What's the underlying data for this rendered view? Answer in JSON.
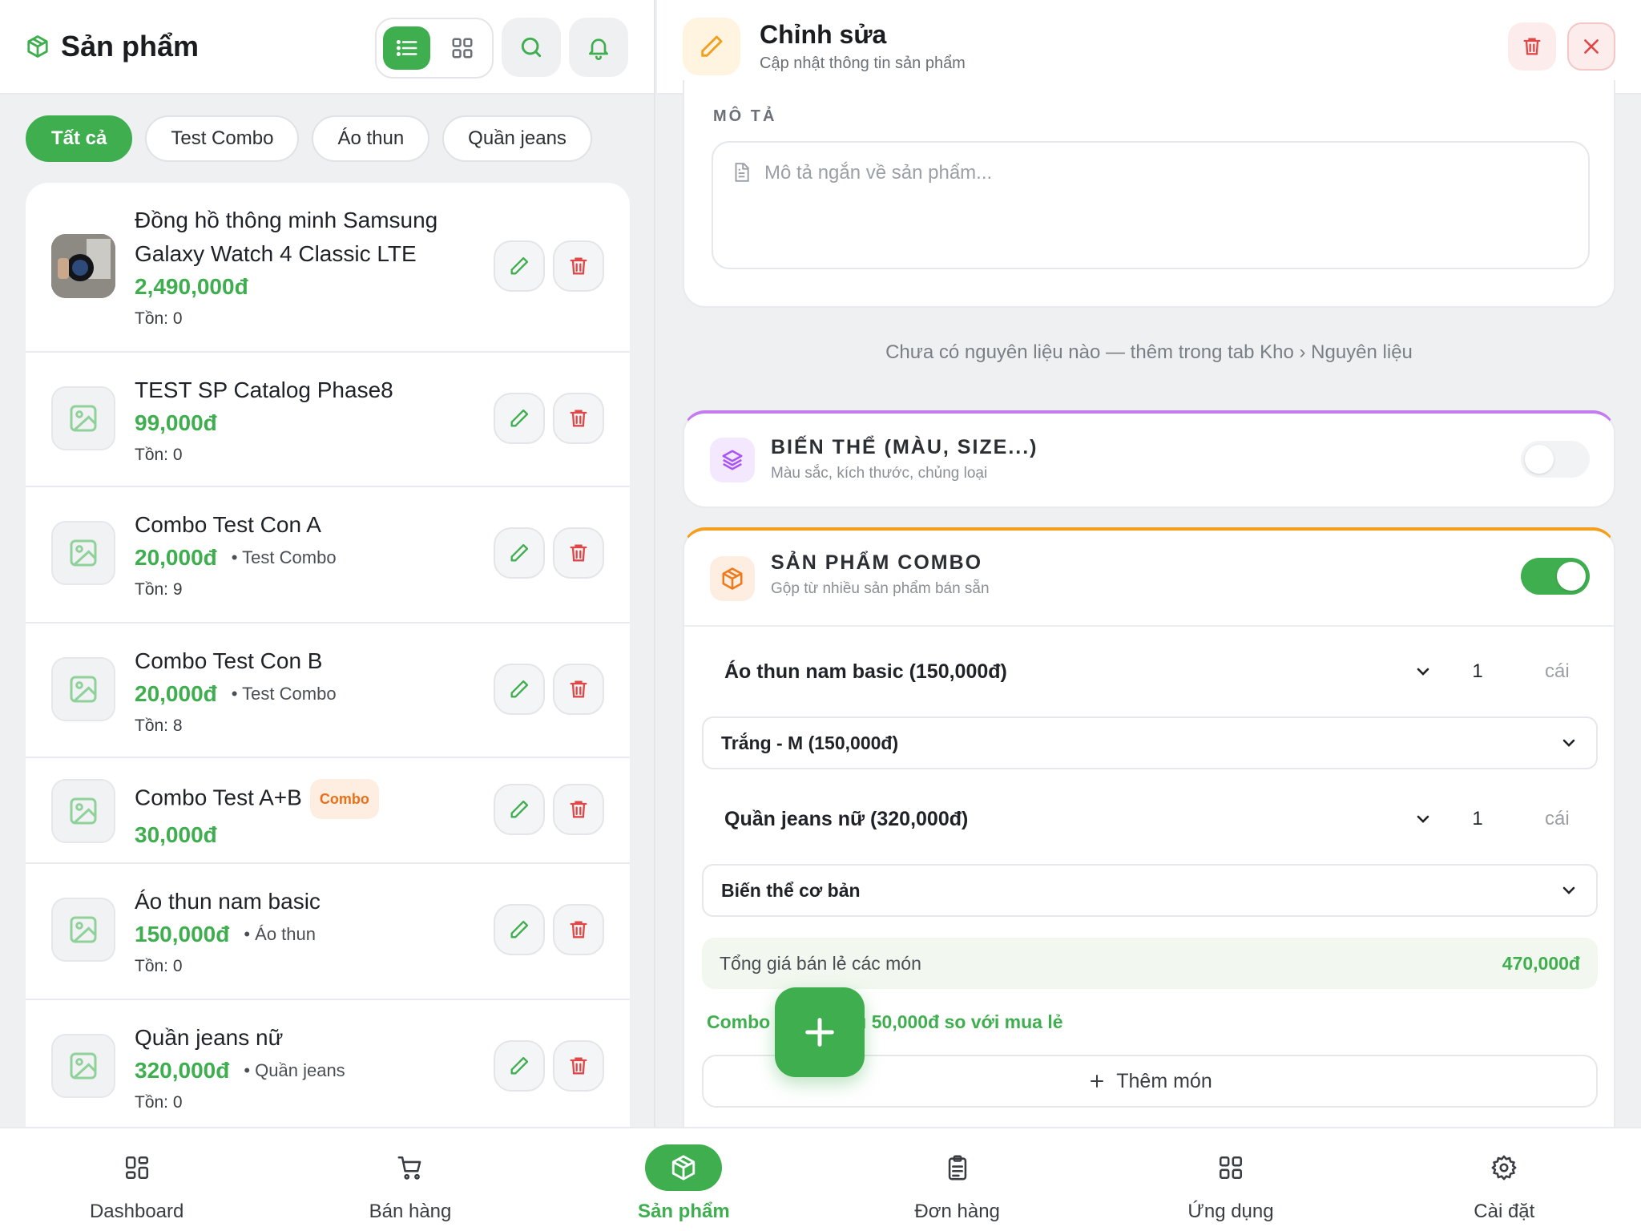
{
  "left": {
    "title": "Sản phẩm",
    "chips": [
      "Tất cả",
      "Test Combo",
      "Áo thun",
      "Quần jeans"
    ],
    "products": [
      {
        "name": "Đồng hồ thông minh Samsung Galaxy Watch 4 Classic LTE",
        "price": "2,490,000đ",
        "category": "",
        "stock": "Tồn: 0",
        "badge": ""
      },
      {
        "name": "TEST SP Catalog Phase8",
        "price": "99,000đ",
        "category": "",
        "stock": "Tồn: 0",
        "badge": ""
      },
      {
        "name": "Combo Test Con A",
        "price": "20,000đ",
        "category": "Test Combo",
        "stock": "Tồn: 9",
        "badge": ""
      },
      {
        "name": "Combo Test Con B",
        "price": "20,000đ",
        "category": "Test Combo",
        "stock": "Tồn: 8",
        "badge": ""
      },
      {
        "name": "Combo Test A+B",
        "price": "30,000đ",
        "category": "",
        "stock": "",
        "badge": "Combo"
      },
      {
        "name": "Áo thun nam basic",
        "price": "150,000đ",
        "category": "Áo thun",
        "stock": "Tồn: 0",
        "badge": ""
      },
      {
        "name": "Quần jeans nữ",
        "price": "320,000đ",
        "category": "Quần jeans",
        "stock": "Tồn: 0",
        "badge": ""
      }
    ]
  },
  "editor": {
    "title": "Chỉnh sửa",
    "subtitle": "Cập nhật thông tin sản phẩm",
    "description_label": "MÔ TẢ",
    "description_placeholder": "Mô tả ngắn về sản phẩm...",
    "ingredients_empty": "Chưa có nguyên liệu nào — thêm trong tab Kho › Nguyên liệu",
    "variants": {
      "title": "BIẾN THỂ (MÀU, SIZE...)",
      "subtitle": "Màu sắc, kích thước, chủng loại",
      "enabled": false
    },
    "combo": {
      "title": "SẢN PHẨM COMBO",
      "subtitle": "Gộp từ nhiều sản phẩm bán sẵn",
      "enabled": true,
      "items": [
        {
          "product": "Áo thun nam basic (150,000đ)",
          "qty": "1",
          "unit": "cái",
          "variant": "Trắng - M (150,000đ)"
        },
        {
          "product": "Quần jeans nữ (320,000đ)",
          "qty": "1",
          "unit": "cái",
          "variant": "Biến thể cơ bản"
        }
      ],
      "total_label": "Tổng giá bán lẻ các món",
      "total_value": "470,000đ",
      "saving_text": "Combo chiết khấu 50,000đ so với mua lẻ",
      "add_label": "Thêm món"
    }
  },
  "nav": [
    {
      "label": "Dashboard",
      "icon": "dashboard-icon"
    },
    {
      "label": "Bán hàng",
      "icon": "cart-icon"
    },
    {
      "label": "Sản phẩm",
      "icon": "box-icon",
      "active": true
    },
    {
      "label": "Đơn hàng",
      "icon": "clipboard-icon"
    },
    {
      "label": "Ứng dụng",
      "icon": "apps-icon"
    },
    {
      "label": "Cài đặt",
      "icon": "gear-icon"
    }
  ],
  "colors": {
    "accent": "#3fae4f",
    "danger": "#e04848",
    "combo_accent": "#f59e1b",
    "variant_accent": "#c37cf0"
  }
}
